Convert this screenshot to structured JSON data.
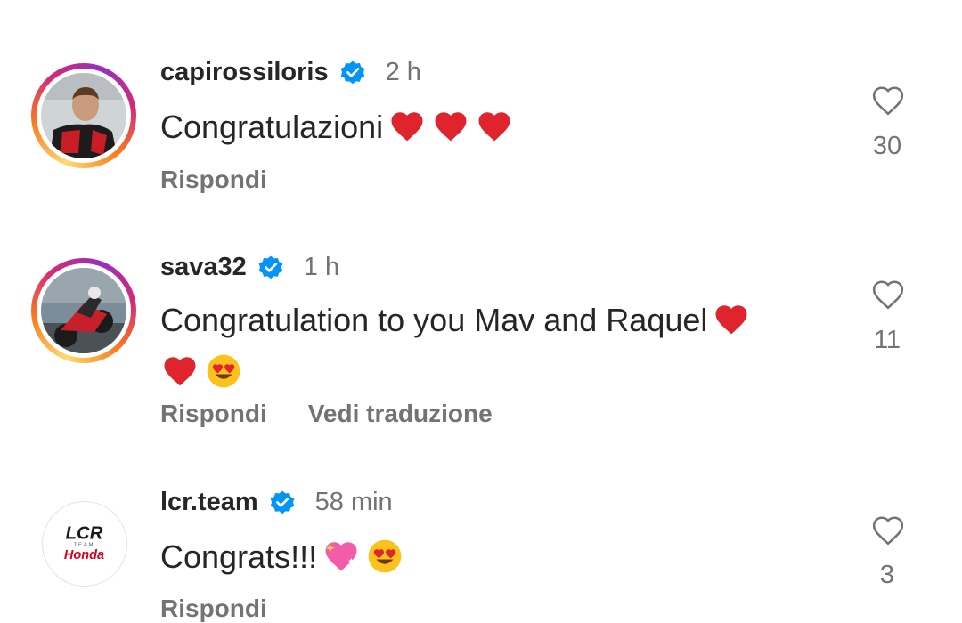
{
  "comments": [
    {
      "username": "capirossiloris",
      "verified": true,
      "time": "2 h",
      "text": "Congratulazioni",
      "emoji": [
        "red-heart",
        "red-heart",
        "red-heart"
      ],
      "likes": "30",
      "reply_label": "Rispondi",
      "story_ring": true
    },
    {
      "username": "sava32",
      "verified": true,
      "time": "1 h",
      "text": "Congratulation to you Mav and Raquel",
      "emoji": [
        "red-heart",
        "red-heart",
        "heart-eyes-face"
      ],
      "likes": "11",
      "reply_label": "Rispondi",
      "translate_label": "Vedi traduzione",
      "story_ring": true
    },
    {
      "username": "lcr.team",
      "verified": true,
      "time": "58 min",
      "text": "Congrats!!!",
      "emoji": [
        "sparkling-heart",
        "heart-eyes-face"
      ],
      "likes": "3",
      "reply_label": "Rispondi",
      "story_ring": false,
      "avatar_logo": {
        "line1": "LCR",
        "line2": "TEAM",
        "line3": "Honda"
      }
    }
  ],
  "colors": {
    "text": "#262626",
    "secondary": "#737373",
    "verified": "#0095f6",
    "heart_red": "#e0242e",
    "logo_red": "#d8001c"
  },
  "icons": {
    "verified": "verified-badge-icon",
    "like": "heart-outline-icon"
  }
}
